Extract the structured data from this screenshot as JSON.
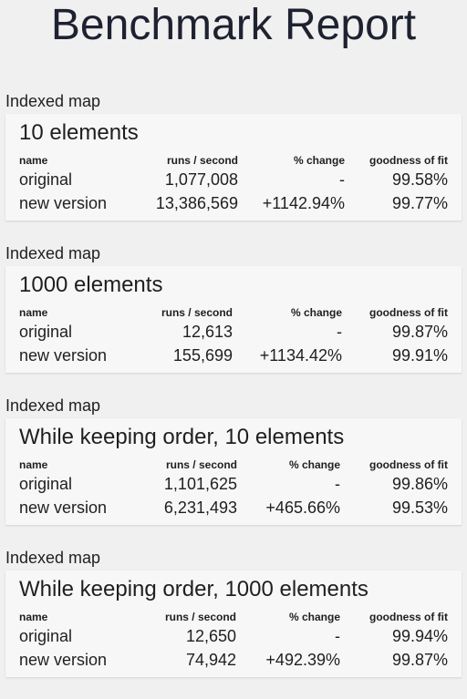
{
  "title": "Benchmark Report",
  "columns": {
    "name": "name",
    "runs": "runs / second",
    "change": "% change",
    "fit": "goodness of fit"
  },
  "sections": [
    {
      "label": "Indexed map",
      "title": "10 elements",
      "rows": [
        {
          "name": "original",
          "runs": "1,077,008",
          "change": "-",
          "fit": "99.58%"
        },
        {
          "name": "new version",
          "runs": "13,386,569",
          "change": "+1142.94%",
          "fit": "99.77%"
        }
      ]
    },
    {
      "label": "Indexed map",
      "title": "1000 elements",
      "rows": [
        {
          "name": "original",
          "runs": "12,613",
          "change": "-",
          "fit": "99.87%"
        },
        {
          "name": "new version",
          "runs": "155,699",
          "change": "+1134.42%",
          "fit": "99.91%"
        }
      ]
    },
    {
      "label": "Indexed map",
      "title": "While keeping order, 10 elements",
      "rows": [
        {
          "name": "original",
          "runs": "1,101,625",
          "change": "-",
          "fit": "99.86%"
        },
        {
          "name": "new version",
          "runs": "6,231,493",
          "change": "+465.66%",
          "fit": "99.53%"
        }
      ]
    },
    {
      "label": "Indexed map",
      "title": "While keeping order, 1000 elements",
      "rows": [
        {
          "name": "original",
          "runs": "12,650",
          "change": "-",
          "fit": "99.94%"
        },
        {
          "name": "new version",
          "runs": "74,942",
          "change": "+492.39%",
          "fit": "99.87%"
        }
      ]
    }
  ]
}
